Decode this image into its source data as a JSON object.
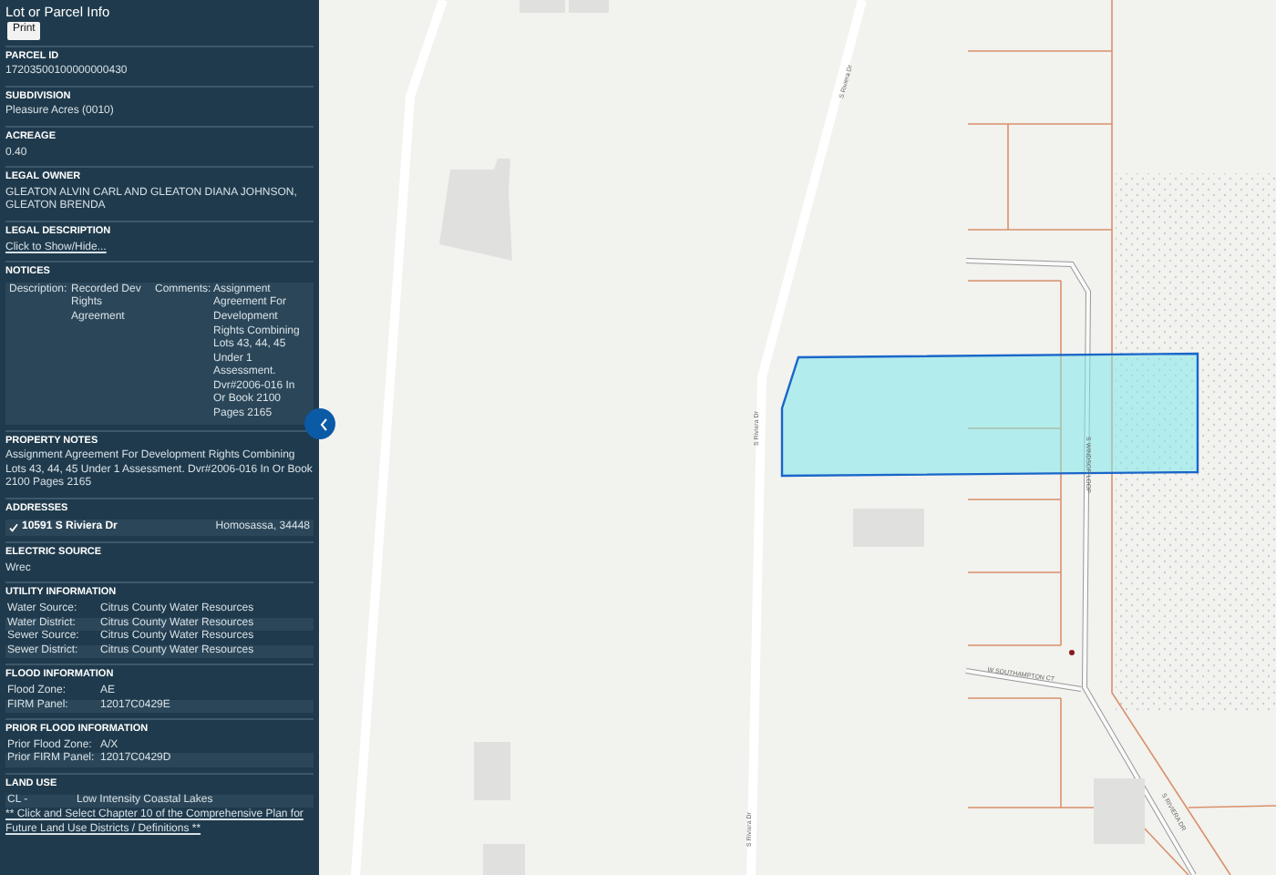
{
  "panel": {
    "title": "Lot or Parcel Info",
    "print_button": "Print",
    "sections": [
      {
        "kind": "text",
        "heading": "PARCEL ID",
        "value": "17203500100000000430"
      },
      {
        "kind": "text",
        "heading": "SUBDIVISION",
        "value": "Pleasure Acres (0010)"
      },
      {
        "kind": "text",
        "heading": "ACREAGE",
        "value": "0.40"
      },
      {
        "kind": "text",
        "heading": "LEGAL OWNER",
        "value": "GLEATON ALVIN CARL AND GLEATON DIANA JOHNSON, GLEATON BRENDA"
      },
      {
        "kind": "link",
        "heading": "LEGAL DESCRIPTION",
        "value": "Click to Show/Hide..."
      },
      {
        "kind": "notices",
        "heading": "NOTICES",
        "cells": [
          "Description:",
          "Recorded Dev Rights Agreement",
          "Comments:",
          "Assignment Agreement For Development Rights Combining Lots 43, 44, 45 Under 1 Assessment. Dvr#2006-016 In Or Book 2100 Pages 2165"
        ]
      },
      {
        "kind": "text",
        "heading": "PROPERTY NOTES",
        "value": "Assignment Agreement For Development Rights Combining Lots 43, 44, 45 Under 1 Assessment. Dvr#2006-016 In Or Book 2100 Pages 2165"
      },
      {
        "kind": "addresses",
        "heading": "ADDRESSES",
        "rows": [
          {
            "checked": true,
            "street": "10591 S Riviera Dr",
            "city": "Homosassa, 34448"
          }
        ]
      },
      {
        "kind": "text",
        "heading": "ELECTRIC SOURCE",
        "value": "Wrec"
      },
      {
        "kind": "table",
        "heading": "UTILITY INFORMATION",
        "rows": [
          [
            "Water Source:",
            "Citrus County Water Resources"
          ],
          [
            "Water District:",
            "Citrus County Water Resources"
          ],
          [
            "Sewer Source:",
            "Citrus County Water Resources"
          ],
          [
            "Sewer District:",
            "Citrus County Water Resources"
          ]
        ]
      },
      {
        "kind": "table",
        "heading": "FLOOD INFORMATION",
        "rows": [
          [
            "Flood Zone:",
            "AE"
          ],
          [
            "FIRM Panel:",
            "12017C0429E"
          ]
        ]
      },
      {
        "kind": "table",
        "heading": "PRIOR FLOOD INFORMATION",
        "rows": [
          [
            "Prior Flood Zone:",
            "A/X"
          ],
          [
            "Prior FIRM Panel:",
            "12017C0429D"
          ]
        ]
      },
      {
        "kind": "land_use",
        "heading": "LAND USE",
        "rows": [
          [
            "CL -",
            "Low Intensity Coastal Lakes"
          ]
        ],
        "link": "** Click and Select Chapter 10 of the Comprehensive Plan for Future Land Use Districts / Definitions **"
      }
    ]
  },
  "map": {
    "road_labels": [
      "S Riviera Dr",
      "S Riviera Dr",
      "S Riviera Dr",
      "S WINDSOR LOOP",
      "W SOUTHAMPTON CT",
      "S RIVIERA DR"
    ]
  }
}
